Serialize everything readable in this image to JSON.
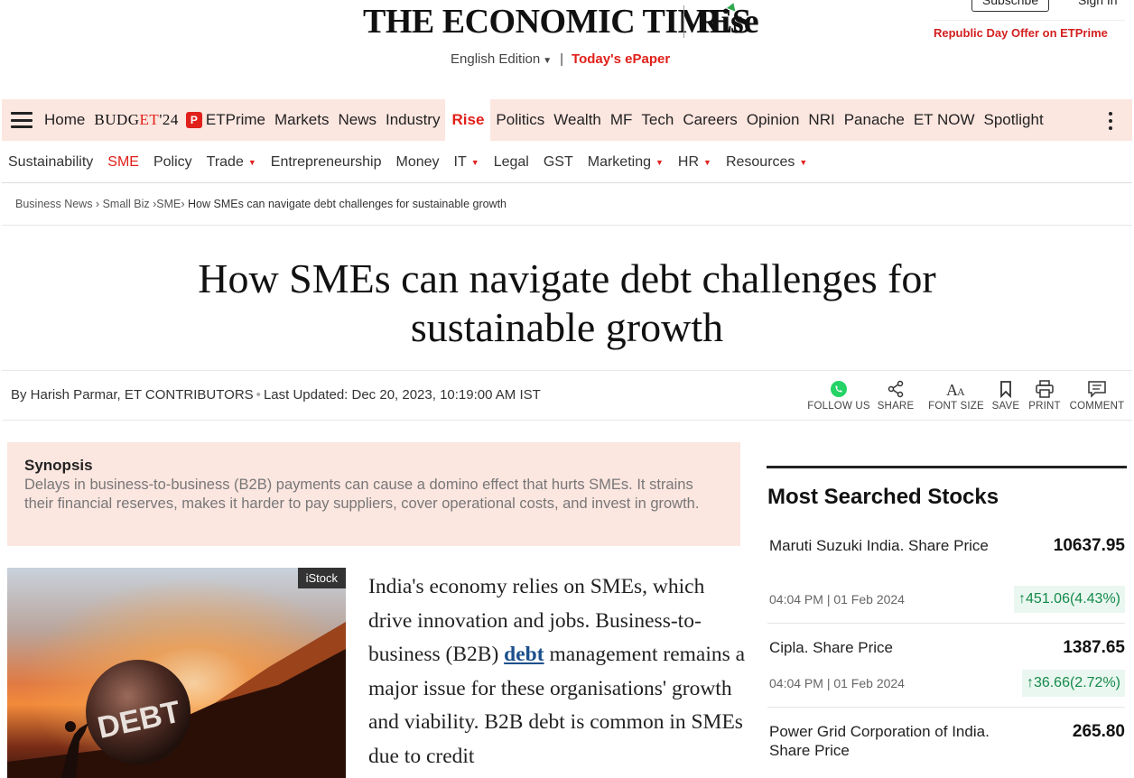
{
  "header": {
    "logo": "THE ECONOMIC TIMES",
    "logo_section": "Rise",
    "edition": "English Edition",
    "edition_separator": "|",
    "epaper": "Today's ePaper",
    "subscribe": "Subscribe",
    "signin": "Sign In",
    "offer": "Republic Day Offer on ETPrime"
  },
  "nav": {
    "primary": [
      "Home",
      "BUDGET'24",
      "ETPrime",
      "Markets",
      "News",
      "Industry",
      "Rise",
      "Politics",
      "Wealth",
      "MF",
      "Tech",
      "Careers",
      "Opinion",
      "NRI",
      "Panache",
      "ET NOW",
      "Spotlight"
    ],
    "budget_prefix": "BUDG",
    "budget_et": "ET",
    "budget_suffix": "'24",
    "etprime_icon_letter": "P",
    "secondary": [
      "Sustainability",
      "SME",
      "Policy",
      "Trade",
      "Entrepreneurship",
      "Money",
      "IT",
      "Legal",
      "GST",
      "Marketing",
      "HR",
      "Resources"
    ]
  },
  "breadcrumb": {
    "items": [
      "Business News",
      "Small Biz",
      "SME"
    ],
    "current": "How SMEs can navigate debt challenges for sustainable growth"
  },
  "article": {
    "headline": "How SMEs can navigate debt challenges for sustainable growth",
    "byline": "By Harish Parmar, ET CONTRIBUTORS",
    "updated": "Last Updated: Dec 20, 2023, 10:19:00 AM IST",
    "tools": [
      "FOLLOW US",
      "SHARE",
      "FONT SIZE",
      "SAVE",
      "PRINT",
      "COMMENT"
    ],
    "synopsis_title": "Synopsis",
    "synopsis": "Delays in business-to-business (B2B) payments can cause a domino effect that hurts SMEs. It strains their financial reserves, makes it harder to pay suppliers, cover operational costs, and invest in growth.",
    "image_credit": "iStock",
    "image_text": "DEBT",
    "body_before_link": "India's economy relies on SMEs, which drive innovation and jobs. Business-to-business (B2B) ",
    "body_link": "debt",
    "body_after_link": " management remains a major issue for these organisations' growth and viability. B2B debt is common in SMEs due to credit"
  },
  "sidebar": {
    "title": "Most Searched Stocks",
    "stocks": [
      {
        "name": "Maruti Suzuki India. Share Price",
        "price": "10637.95",
        "time": "04:04 PM | 01 Feb 2024",
        "change": "451.06(4.43%)"
      },
      {
        "name": "Cipla. Share Price",
        "price": "1387.65",
        "time": "04:04 PM | 01 Feb 2024",
        "change": "36.66(2.72%)"
      },
      {
        "name": "Power Grid Corporation of India. Share Price",
        "price": "265.80"
      }
    ]
  },
  "colors": {
    "brand_red": "#e0201a",
    "nav_bg": "#fce6e0",
    "gain_green": "#148a4a",
    "link_blue": "#1a4f8c"
  }
}
